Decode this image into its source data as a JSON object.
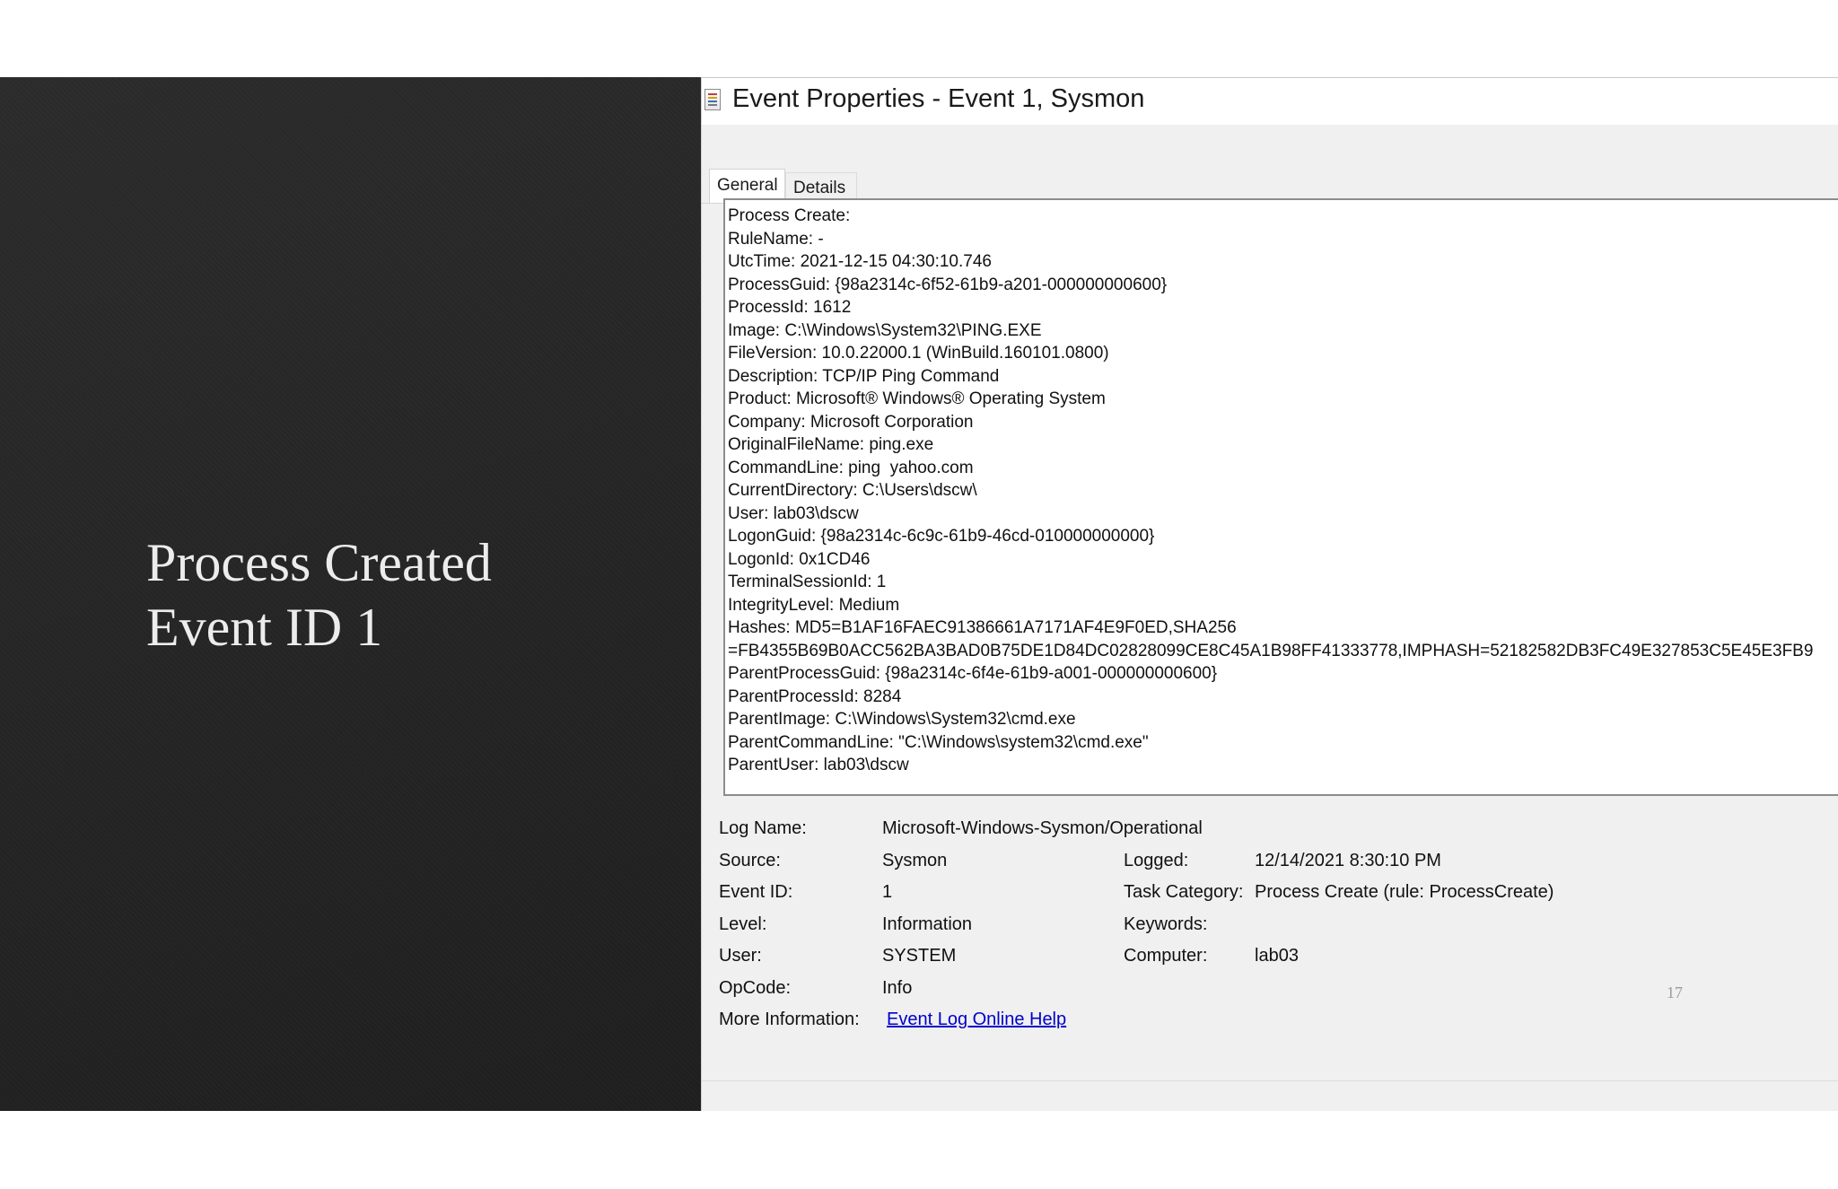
{
  "slide": {
    "title_line1": "Process Created",
    "title_line2": "Event ID 1",
    "page_number": "17"
  },
  "dialog": {
    "title": "Event Properties - Event 1, Sysmon",
    "tabs": [
      "General",
      "Details"
    ],
    "description_lines": [
      "Process Create:",
      "RuleName: -",
      "UtcTime: 2021-12-15 04:30:10.746",
      "ProcessGuid: {98a2314c-6f52-61b9-a201-000000000600}",
      "ProcessId: 1612",
      "Image: C:\\Windows\\System32\\PING.EXE",
      "FileVersion: 10.0.22000.1 (WinBuild.160101.0800)",
      "Description: TCP/IP Ping Command",
      "Product: Microsoft® Windows® Operating System",
      "Company: Microsoft Corporation",
      "OriginalFileName: ping.exe",
      "CommandLine: ping  yahoo.com",
      "CurrentDirectory: C:\\Users\\dscw\\",
      "User: lab03\\dscw",
      "LogonGuid: {98a2314c-6c9c-61b9-46cd-010000000000}",
      "LogonId: 0x1CD46",
      "TerminalSessionId: 1",
      "IntegrityLevel: Medium",
      "Hashes: MD5=B1AF16FAEC91386661A7171AF4E9F0ED,SHA256",
      "=FB4355B69B0ACC562BA3BAD0B75DE1D84DC02828099CE8C45A1B98FF41333778,IMPHASH=52182582DB3FC49E327853C5E45E3FB9",
      "ParentProcessGuid: {98a2314c-6f4e-61b9-a001-000000000600}",
      "ParentProcessId: 8284",
      "ParentImage: C:\\Windows\\System32\\cmd.exe",
      "ParentCommandLine: \"C:\\Windows\\system32\\cmd.exe\"",
      "ParentUser: lab03\\dscw"
    ],
    "fields": {
      "log_name_label": "Log Name:",
      "log_name": "Microsoft-Windows-Sysmon/Operational",
      "source_label": "Source:",
      "source": "Sysmon",
      "logged_label": "Logged:",
      "logged": "12/14/2021 8:30:10 PM",
      "event_id_label": "Event ID:",
      "event_id": "1",
      "task_category_label": "Task Category:",
      "task_category": "Process Create (rule: ProcessCreate)",
      "level_label": "Level:",
      "level": "Information",
      "keywords_label": "Keywords:",
      "keywords": "",
      "user_label": "User:",
      "user": "SYSTEM",
      "computer_label": "Computer:",
      "computer": "lab03",
      "opcode_label": "OpCode:",
      "opcode": "Info",
      "more_info_label": "More Information:",
      "more_info_link": "Event Log Online Help"
    }
  }
}
